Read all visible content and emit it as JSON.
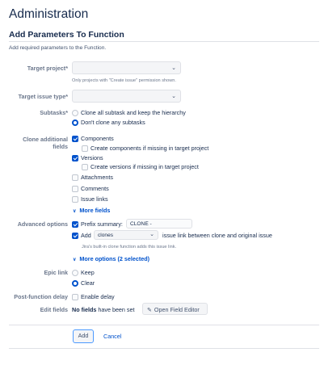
{
  "page_title": "Administration",
  "section_title": "Add Parameters To Function",
  "description": "Add required parameters to the Function.",
  "target_project": {
    "label": "Target project*",
    "value": "",
    "hint": "Only projects with \"Create issue\" permission shown."
  },
  "target_issue_type": {
    "label": "Target issue type*",
    "value": ""
  },
  "subtasks": {
    "label": "Subtasks*",
    "options": [
      {
        "label": "Clone all subtask and keep the hierarchy",
        "selected": false
      },
      {
        "label": "Don't clone any subtasks",
        "selected": true
      }
    ]
  },
  "clone_fields": {
    "label_line1": "Clone additional",
    "label_line2": "fields",
    "components": {
      "label": "Components",
      "checked": true
    },
    "create_components": {
      "label": "Create components if missing in target project",
      "checked": false
    },
    "versions": {
      "label": "Versions",
      "checked": true
    },
    "create_versions": {
      "label": "Create versions if missing in target project",
      "checked": false
    },
    "attachments": {
      "label": "Attachments",
      "checked": false
    },
    "comments": {
      "label": "Comments",
      "checked": false
    },
    "issue_links": {
      "label": "Issue links",
      "checked": false
    },
    "more_fields": "More fields"
  },
  "advanced": {
    "label": "Advanced options",
    "prefix_label": "Prefix summary:",
    "prefix_value": "CLONE -",
    "prefix_checked": true,
    "add_label": "Add",
    "add_checked": true,
    "link_type": "clones",
    "link_suffix": "issue link between clone and original issue",
    "hint": "Jira's built-in clone function adds this issue link.",
    "more_options": "More options (2 selected)"
  },
  "epic_link": {
    "label": "Epic link",
    "options": [
      {
        "label": "Keep",
        "selected": false
      },
      {
        "label": "Clear",
        "selected": true
      }
    ]
  },
  "post_function_delay": {
    "label": "Post-function delay",
    "option": "Enable delay",
    "checked": false
  },
  "edit_fields": {
    "label": "Edit fields",
    "status_bold": "No fields",
    "status_rest": "have been set",
    "button": "Open Field Editor"
  },
  "actions": {
    "add": "Add",
    "cancel": "Cancel"
  },
  "colors": {
    "accent": "#0052cc",
    "text": "#172b4d",
    "muted": "#6b778c"
  }
}
